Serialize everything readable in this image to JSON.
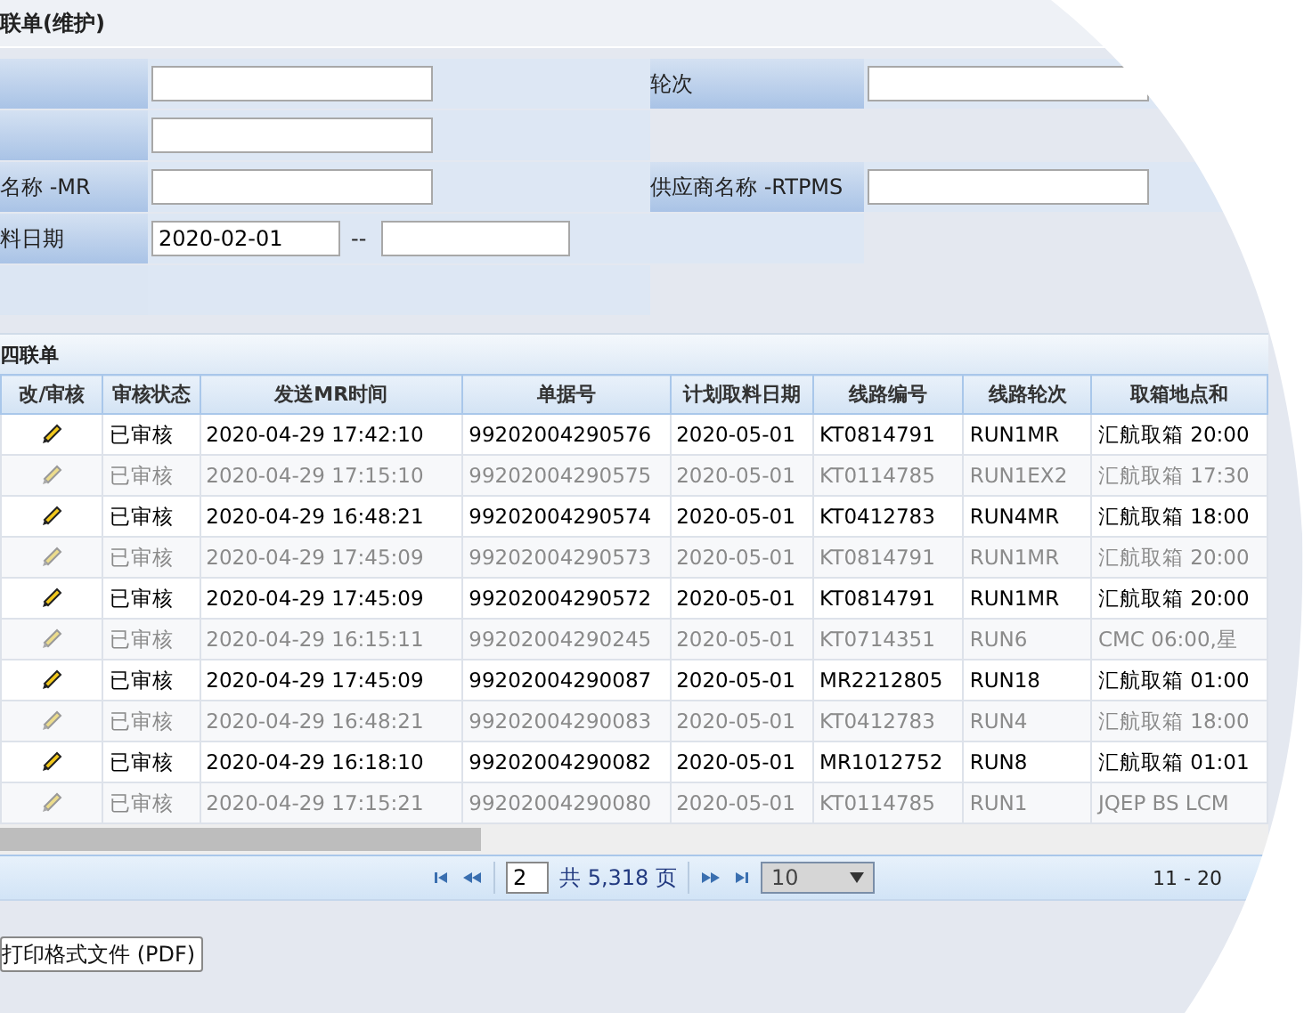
{
  "title": "联单(维护)",
  "form": {
    "rows": [
      {
        "label": "",
        "value": "",
        "right_label": "轮次",
        "right_value": ""
      },
      {
        "label": "",
        "value": ""
      },
      {
        "label": "名称 -MR",
        "value": "",
        "right_label": "供应商名称 -RTPMS",
        "right_value": ""
      },
      {
        "label": "料日期",
        "kind": "range",
        "value": "2020-02-01",
        "separator": "--",
        "value2": ""
      },
      {
        "label": "",
        "kind": "blank"
      }
    ]
  },
  "grid": {
    "title": "四联单",
    "columns": [
      "改/审核",
      "审核状态",
      "发送MR时间",
      "单据号",
      "计划取料日期",
      "线路编号",
      "线路轮次",
      "取箱地点和"
    ],
    "rows": [
      {
        "muted": false,
        "cells": [
          "",
          "已审核",
          "2020-04-29 17:42:10",
          "99202004290576",
          "2020-05-01",
          "KT0814791",
          "RUN1MR",
          "汇航取箱 20:00"
        ]
      },
      {
        "muted": true,
        "cells": [
          "",
          "已审核",
          "2020-04-29 17:15:10",
          "99202004290575",
          "2020-05-01",
          "KT0114785",
          "RUN1EX2",
          "汇航取箱 17:30"
        ]
      },
      {
        "muted": false,
        "cells": [
          "",
          "已审核",
          "2020-04-29 16:48:21",
          "99202004290574",
          "2020-05-01",
          "KT0412783",
          "RUN4MR",
          "汇航取箱 18:00"
        ]
      },
      {
        "muted": true,
        "cells": [
          "",
          "已审核",
          "2020-04-29 17:45:09",
          "99202004290573",
          "2020-05-01",
          "KT0814791",
          "RUN1MR",
          "汇航取箱 20:00"
        ]
      },
      {
        "muted": false,
        "cells": [
          "",
          "已审核",
          "2020-04-29 17:45:09",
          "99202004290572",
          "2020-05-01",
          "KT0814791",
          "RUN1MR",
          "汇航取箱 20:00"
        ]
      },
      {
        "muted": true,
        "cells": [
          "",
          "已审核",
          "2020-04-29 16:15:11",
          "99202004290245",
          "2020-05-01",
          "KT0714351",
          "RUN6",
          "CMC 06:00,星"
        ]
      },
      {
        "muted": false,
        "cells": [
          "",
          "已审核",
          "2020-04-29 17:45:09",
          "99202004290087",
          "2020-05-01",
          "MR2212805",
          "RUN18",
          "汇航取箱 01:00"
        ]
      },
      {
        "muted": true,
        "cells": [
          "",
          "已审核",
          "2020-04-29 16:48:21",
          "99202004290083",
          "2020-05-01",
          "KT0412783",
          "RUN4",
          "汇航取箱 18:00"
        ]
      },
      {
        "muted": false,
        "cells": [
          "",
          "已审核",
          "2020-04-29 16:18:10",
          "99202004290082",
          "2020-05-01",
          "MR1012752",
          "RUN8",
          "汇航取箱 01:01"
        ]
      },
      {
        "muted": true,
        "cells": [
          "",
          "已审核",
          "2020-04-29 17:15:21",
          "99202004290080",
          "2020-05-01",
          "KT0114785",
          "RUN1",
          "JQEP BS LCM"
        ]
      }
    ]
  },
  "pager": {
    "page": "2",
    "total": "共 5,318 页",
    "page_size": "10",
    "range": "11 - 20"
  },
  "button": "打印格式文件 (PDF)"
}
